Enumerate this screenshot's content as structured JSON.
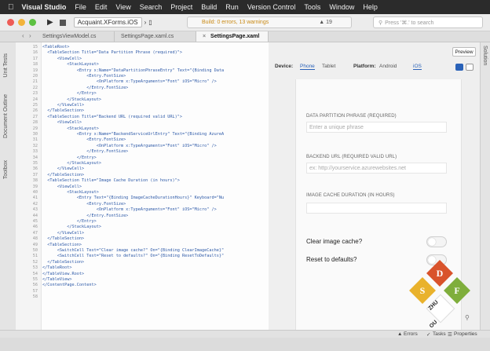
{
  "menubar": {
    "apple": "",
    "items": [
      "Visual Studio",
      "File",
      "Edit",
      "View",
      "Search",
      "Project",
      "Build",
      "Run",
      "Version Control",
      "Tools",
      "Window",
      "Help"
    ]
  },
  "toolbar": {
    "run_glyph": "▶",
    "configuration": "Acquaint.XForms.iOS",
    "build_status": "Build: 0 errors, 13 warnings",
    "warning_count": "19",
    "search_placeholder": "Press '⌘.' to search"
  },
  "tabs": [
    {
      "label": "SettingsViewModel.cs",
      "active": false
    },
    {
      "label": "SettingsPage.xaml.cs",
      "active": false
    },
    {
      "label": "SettingsPage.xaml",
      "active": true
    }
  ],
  "left_dock": [
    "Unit Tests",
    "Document Outline",
    "Toolbox"
  ],
  "right_dock": [
    "Solution"
  ],
  "code_lines": [
    {
      "n": "15",
      "t": "<TableRoot>"
    },
    {
      "n": "16",
      "t": "  <TableSection Title=\"Data Partition Phrase (required)\">"
    },
    {
      "n": "17",
      "t": "      <ViewCell>"
    },
    {
      "n": "18",
      "t": "          <StackLayout>"
    },
    {
      "n": "19",
      "t": "              <Entry x:Name=\"DataPartitionPhraseEntry\" Text=\"{Binding Data"
    },
    {
      "n": "20",
      "t": "                  <Entry.FontSize>"
    },
    {
      "n": "21",
      "t": "                      <OnPlatform x:TypeArguments=\"Font\" iOS=\"Micro\" />"
    },
    {
      "n": "22",
      "t": "                  </Entry.FontSize>"
    },
    {
      "n": "23",
      "t": "              </Entry>"
    },
    {
      "n": "24",
      "t": "          </StackLayout>"
    },
    {
      "n": "25",
      "t": "      </ViewCell>"
    },
    {
      "n": "26",
      "t": "  </TableSection>"
    },
    {
      "n": "27",
      "t": "  <TableSection Title=\"Backend URL (required valid URL)\">"
    },
    {
      "n": "28",
      "t": "      <ViewCell>"
    },
    {
      "n": "29",
      "t": "          <StackLayout>"
    },
    {
      "n": "30",
      "t": "              <Entry x:Name=\"BackendServiceUrlEntry\" Text=\"{Binding AzureA"
    },
    {
      "n": "31",
      "t": "                  <Entry.FontSize>"
    },
    {
      "n": "32",
      "t": "                      <OnPlatform x:TypeArguments=\"Font\" iOS=\"Micro\" />"
    },
    {
      "n": "33",
      "t": "                  </Entry.FontSize>"
    },
    {
      "n": "34",
      "t": "              </Entry>"
    },
    {
      "n": "35",
      "t": "          </StackLayout>"
    },
    {
      "n": "36",
      "t": "      </ViewCell>"
    },
    {
      "n": "37",
      "t": "  </TableSection>"
    },
    {
      "n": "38",
      "t": "  <TableSection Title=\"Image Cache Duration (in hours)\">"
    },
    {
      "n": "39",
      "t": "      <ViewCell>"
    },
    {
      "n": "40",
      "t": "          <StackLayout>"
    },
    {
      "n": "41",
      "t": "              <Entry Text=\"{Binding ImageCacheDurationHours}\" Keyboard=\"Nu"
    },
    {
      "n": "42",
      "t": "                  <Entry.FontSize>"
    },
    {
      "n": "43",
      "t": "                      <OnPlatform x:TypeArguments=\"Font\" iOS=\"Micro\" />"
    },
    {
      "n": "44",
      "t": "                  </Entry.FontSize>"
    },
    {
      "n": "45",
      "t": "              </Entry>"
    },
    {
      "n": "46",
      "t": "          </StackLayout>"
    },
    {
      "n": "47",
      "t": "      </ViewCell>"
    },
    {
      "n": "48",
      "t": "  </TableSection>"
    },
    {
      "n": "49",
      "t": "  <TableSection>"
    },
    {
      "n": "50",
      "t": "      <SwitchCell Text=\"Clear image cache?\" On=\"{Binding ClearImageCache}\""
    },
    {
      "n": "51",
      "t": "      <SwitchCell Text=\"Reset to defaults?\" On=\"{Binding ResetToDefaults}\""
    },
    {
      "n": "52",
      "t": "  </TableSection>"
    },
    {
      "n": "53",
      "t": "</TableRoot>"
    },
    {
      "n": "54",
      "t": "</TableView.Root>"
    },
    {
      "n": "55",
      "t": "</TableView>"
    },
    {
      "n": "56",
      "t": "</ContentPage.Content>"
    },
    {
      "n": "57",
      "t": ""
    },
    {
      "n": "58",
      "t": ""
    }
  ],
  "preview": {
    "button": "Preview",
    "device_label": "Device:",
    "device_options": [
      "Phone",
      "Tablet"
    ],
    "platform_label": "Platform:",
    "platform_options": [
      "Android",
      "iOS"
    ],
    "sections": [
      {
        "title": "DATA PARTITION PHRASE (REQUIRED)",
        "placeholder": "Enter a unique phrase"
      },
      {
        "title": "BACKEND URL (REQUIRED VALID URL)",
        "placeholder": "ex: http://yourservice.azurewebsites.net"
      },
      {
        "title": "IMAGE CACHE DURATION (IN HOURS)",
        "placeholder": ""
      }
    ],
    "switches": [
      {
        "label": "Clear image cache?",
        "on": false
      },
      {
        "label": "Reset to defaults?",
        "on": false
      }
    ]
  },
  "watermark": {
    "letters": [
      "D",
      "S",
      "F",
      "ZHU",
      "OU"
    ],
    "colors": [
      "#d9532c",
      "#e9b22c",
      "#7fae3c",
      "#2d7ec4"
    ]
  },
  "statusbar": {
    "errors": "Errors",
    "tasks": "Tasks",
    "properties": "Properties"
  }
}
